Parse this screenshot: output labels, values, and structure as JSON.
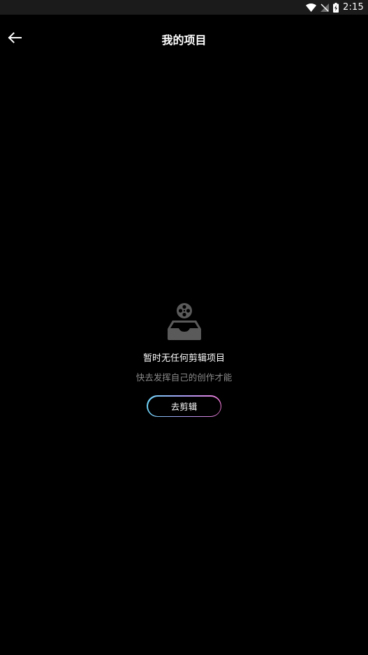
{
  "status_bar": {
    "time": "2:15",
    "icons": [
      "wifi-icon",
      "no-signal-icon",
      "battery-charging-icon"
    ]
  },
  "header": {
    "back_icon": "arrow-left-icon",
    "title": "我的项目"
  },
  "empty_state": {
    "illustration_icon": "film-reel-inbox-icon",
    "title": "暂时无任何剪辑项目",
    "subtitle": "快去发挥自己的创作才能",
    "button_label": "去剪辑"
  },
  "colors": {
    "background": "#000000",
    "status_bar": "#1b1b1b",
    "subtitle_text": "#8a8a8a",
    "button_gradient_start": "#6ed4f6",
    "button_gradient_end": "#f07ad8",
    "illustration": "#5a5a5a"
  }
}
